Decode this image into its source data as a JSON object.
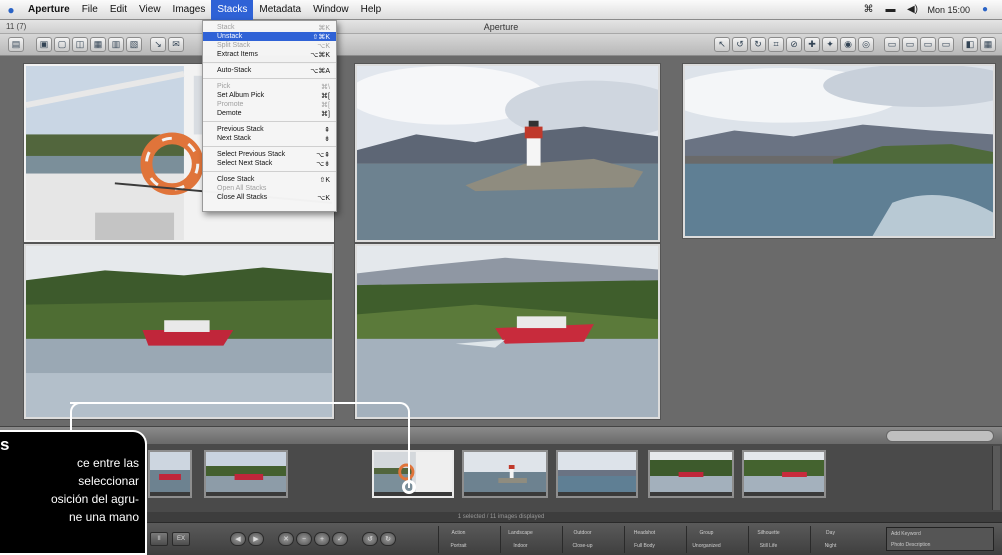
{
  "menubar": {
    "app_name": "Aperture",
    "items": [
      "File",
      "Edit",
      "View",
      "Images",
      "Stacks",
      "Metadata",
      "Window",
      "Help"
    ],
    "active_item": "Stacks",
    "clock": "Mon 15:00"
  },
  "window": {
    "title": "Aperture",
    "image_count": "11 (7)"
  },
  "stacks_menu": {
    "items": [
      {
        "label": "Stack",
        "shortcut": "⌘K",
        "state": "disabled"
      },
      {
        "label": "Unstack",
        "shortcut": "⇧⌘K",
        "state": "highlight"
      },
      {
        "label": "Split Stack",
        "shortcut": "⌥K",
        "state": "disabled"
      },
      {
        "label": "Extract Items",
        "shortcut": "⌥⌘K",
        "state": "normal"
      },
      {
        "sep": true
      },
      {
        "label": "Auto-Stack",
        "shortcut": "⌥⌘A",
        "state": "normal"
      },
      {
        "sep": true
      },
      {
        "label": "Pick",
        "shortcut": "⌘\\",
        "state": "disabled"
      },
      {
        "label": "Set Album Pick",
        "shortcut": "⌘[",
        "state": "normal"
      },
      {
        "label": "Promote",
        "shortcut": "⌘[",
        "state": "disabled"
      },
      {
        "label": "Demote",
        "shortcut": "⌘]",
        "state": "normal"
      },
      {
        "sep": true
      },
      {
        "label": "Previous Stack",
        "shortcut": "⇞",
        "state": "normal"
      },
      {
        "label": "Next Stack",
        "shortcut": "⇟",
        "state": "normal"
      },
      {
        "sep": true
      },
      {
        "label": "Select Previous Stack",
        "shortcut": "⌥⇞",
        "state": "normal"
      },
      {
        "label": "Select Next Stack",
        "shortcut": "⌥⇟",
        "state": "normal"
      },
      {
        "sep": true
      },
      {
        "label": "Close Stack",
        "shortcut": "⇧K",
        "state": "normal"
      },
      {
        "label": "Open All Stacks",
        "shortcut": "",
        "state": "disabled"
      },
      {
        "label": "Close All Stacks",
        "shortcut": "⌥K",
        "state": "normal"
      }
    ]
  },
  "browser": {
    "status": "1 selected / 11 images displayed"
  },
  "controlbar": {
    "keyword_buttons": [
      {
        "top": "Action",
        "bottom": "Portrait"
      },
      {
        "top": "Landscape",
        "bottom": "Indoor"
      },
      {
        "top": "Outdoor",
        "bottom": "Close-up"
      },
      {
        "top": "Headshot",
        "bottom": "Full Body"
      },
      {
        "top": "Group",
        "bottom": "Unorganized"
      },
      {
        "top": "Silhouette",
        "bottom": "Still Life"
      },
      {
        "top": "Day",
        "bottom": "Night"
      }
    ],
    "keyword_field": {
      "top": "Add Keyword",
      "bottom": "Photo Description"
    },
    "small_buttons": [
      "II",
      "EX"
    ]
  },
  "callout": {
    "heading": "s",
    "lines": [
      "ce entre las",
      "seleccionar",
      "osición del agru-",
      "ne una mano"
    ]
  }
}
